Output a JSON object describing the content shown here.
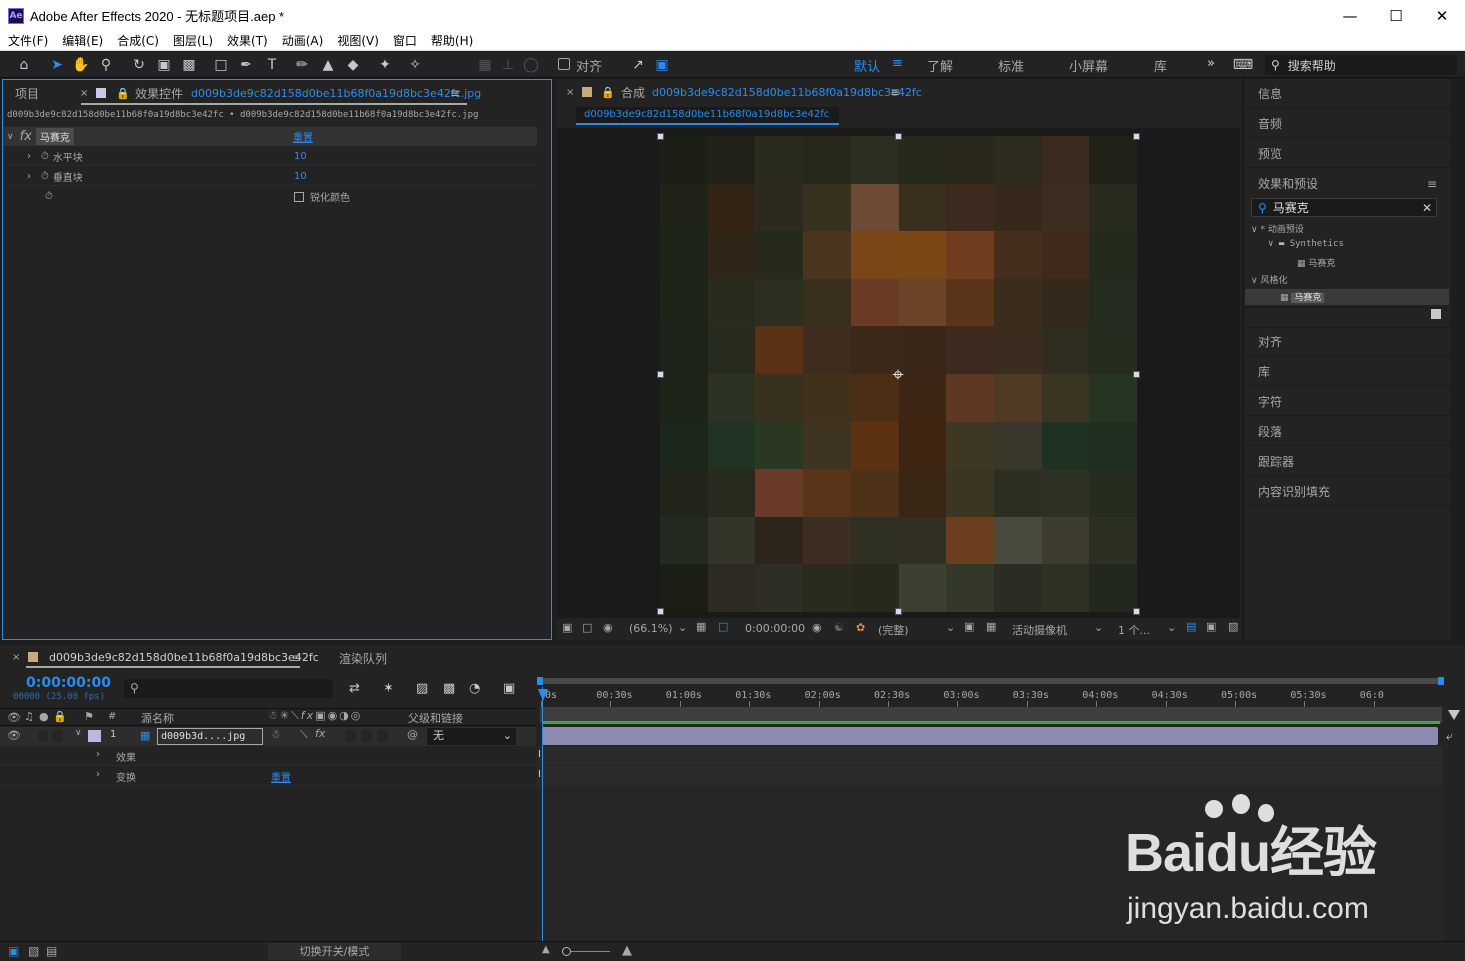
{
  "window": {
    "title": "Adobe After Effects 2020 - 无标题项目.aep *",
    "logo": "Ae"
  },
  "menu": [
    "文件(F)",
    "编辑(E)",
    "合成(C)",
    "图层(L)",
    "效果(T)",
    "动画(A)",
    "视图(V)",
    "窗口",
    "帮助(H)"
  ],
  "toolbar": {
    "snap_label": "对齐",
    "workspaces": [
      "默认",
      "了解",
      "标准",
      "小屏幕",
      "库"
    ],
    "active_workspace": "默认",
    "search_help": "搜索帮助"
  },
  "project_tab": "项目",
  "effect_controls": {
    "tab_label": "效果控件",
    "tab_file": "d009b3de9c82d158d0be11b68f0a19d8bc3e42fc.jpg",
    "breadcrumb": "d009b3de9c82d158d0be11b68f0a19d8bc3e42fc • d009b3de9c82d158d0be11b68f0a19d8bc3e42fc.jpg",
    "effect_name": "马赛克",
    "reset_label": "重置",
    "props": [
      {
        "name": "水平块",
        "value": "10"
      },
      {
        "name": "垂直块",
        "value": "10"
      },
      {
        "name": "",
        "value": "锐化颜色"
      }
    ]
  },
  "composition": {
    "tab_label": "合成",
    "comp_name": "d009b3de9c82d158d0be11b68f0a19d8bc3e42fc",
    "footer": {
      "zoom": "(66.1%)",
      "timecode": "0:00:00:00",
      "resolution": "(完整)",
      "camera": "活动摄像机",
      "views": "1 个..."
    },
    "mosaic_colors": [
      "#1c1f16",
      "#222219",
      "#2a2a1d",
      "#27271b",
      "#2e2e20",
      "#262a1c",
      "#2a281c",
      "#2d2a1e",
      "#3a2b1e",
      "#1f2217",
      "#1f2318",
      "#332416",
      "#2c2a1e",
      "#37301f",
      "#6d4a33",
      "#3a2e1f",
      "#3d2a1e",
      "#36281b",
      "#3b2e20",
      "#262b1d",
      "#1e2318",
      "#2f2618",
      "#262a1c",
      "#4a3420",
      "#7a4517",
      "#7b4716",
      "#703d1f",
      "#452e1e",
      "#3f2a1b",
      "#242b1d",
      "#1e2418",
      "#2a2a1d",
      "#2c2e1f",
      "#3a2f1c",
      "#6b3a25",
      "#6e4429",
      "#5a3519",
      "#3a2d1e",
      "#33291b",
      "#232c1e",
      "#1d2318",
      "#272b1d",
      "#5b3216",
      "#3e2d1e",
      "#3a2818",
      "#3a2719",
      "#3d2a1e",
      "#3b2c20",
      "#2f2d20",
      "#262d1f",
      "#1c2317",
      "#2d3322",
      "#393120",
      "#40311d",
      "#4b2f15",
      "#3d2615",
      "#5e3822",
      "#4f3a24",
      "#3a3422",
      "#263422",
      "#1b271b",
      "#1f3425",
      "#2a3822",
      "#3f3322",
      "#5c3212",
      "#3d2511",
      "#3c3824",
      "#38372a",
      "#1d3223",
      "#1f3020",
      "#212419",
      "#262b1e",
      "#6a3b28",
      "#5a3418",
      "#4d3119",
      "#3a2614",
      "#3b3622",
      "#2d2f22",
      "#2c3124",
      "#252d1f",
      "#232a1f",
      "#343529",
      "#2d241b",
      "#3c2f22",
      "#2f3022",
      "#332e22",
      "#6c3e1d",
      "#484a3e",
      "#3d3c2e",
      "#2d2f22",
      "#1b1e15",
      "#2d2b22",
      "#2f2e24",
      "#2a2a1e",
      "#262a1a",
      "#3b4030",
      "#33382a",
      "#2a2e22",
      "#2e3124",
      "#23281c"
    ]
  },
  "right_panel": {
    "info": "信息",
    "audio": "音频",
    "preview": "预览",
    "effects_presets": "效果和预设",
    "search_value": "马赛克",
    "tree": [
      {
        "label": "* 动画预设",
        "level": 0
      },
      {
        "label": "Synthetics",
        "level": 1
      },
      {
        "label": "马赛克",
        "level": 2
      },
      {
        "label": "风格化",
        "level": 0
      },
      {
        "label": "马赛克",
        "level": 1
      }
    ],
    "lower": [
      "对齐",
      "库",
      "字符",
      "段落",
      "跟踪器",
      "内容识别填充"
    ]
  },
  "timeline": {
    "comp_tab": "d009b3de9c82d158d0be11b68f0a19d8bc3e42fc",
    "render_queue": "渲染队列",
    "timecode": "0:00:00:00",
    "frame_fps": "00000 (25.00 fps)",
    "col_source": "源名称",
    "col_parent": "父级和链接",
    "col_num": "#",
    "ruler": [
      "0s",
      "00:30s",
      "01:00s",
      "01:30s",
      "02:00s",
      "02:30s",
      "03:00s",
      "03:30s",
      "04:00s",
      "04:30s",
      "05:00s",
      "05:30s",
      "06:0"
    ],
    "layer": {
      "index": "1",
      "name": "d009b3d....jpg",
      "parent": "无"
    },
    "sub": [
      {
        "label": "效果",
        "value": ""
      },
      {
        "label": "变换",
        "value": "重置"
      }
    ],
    "footer_toggle": "切换开关/模式"
  },
  "watermark": {
    "brand": "Baidu经验",
    "url": "jingyan.baidu.com"
  }
}
